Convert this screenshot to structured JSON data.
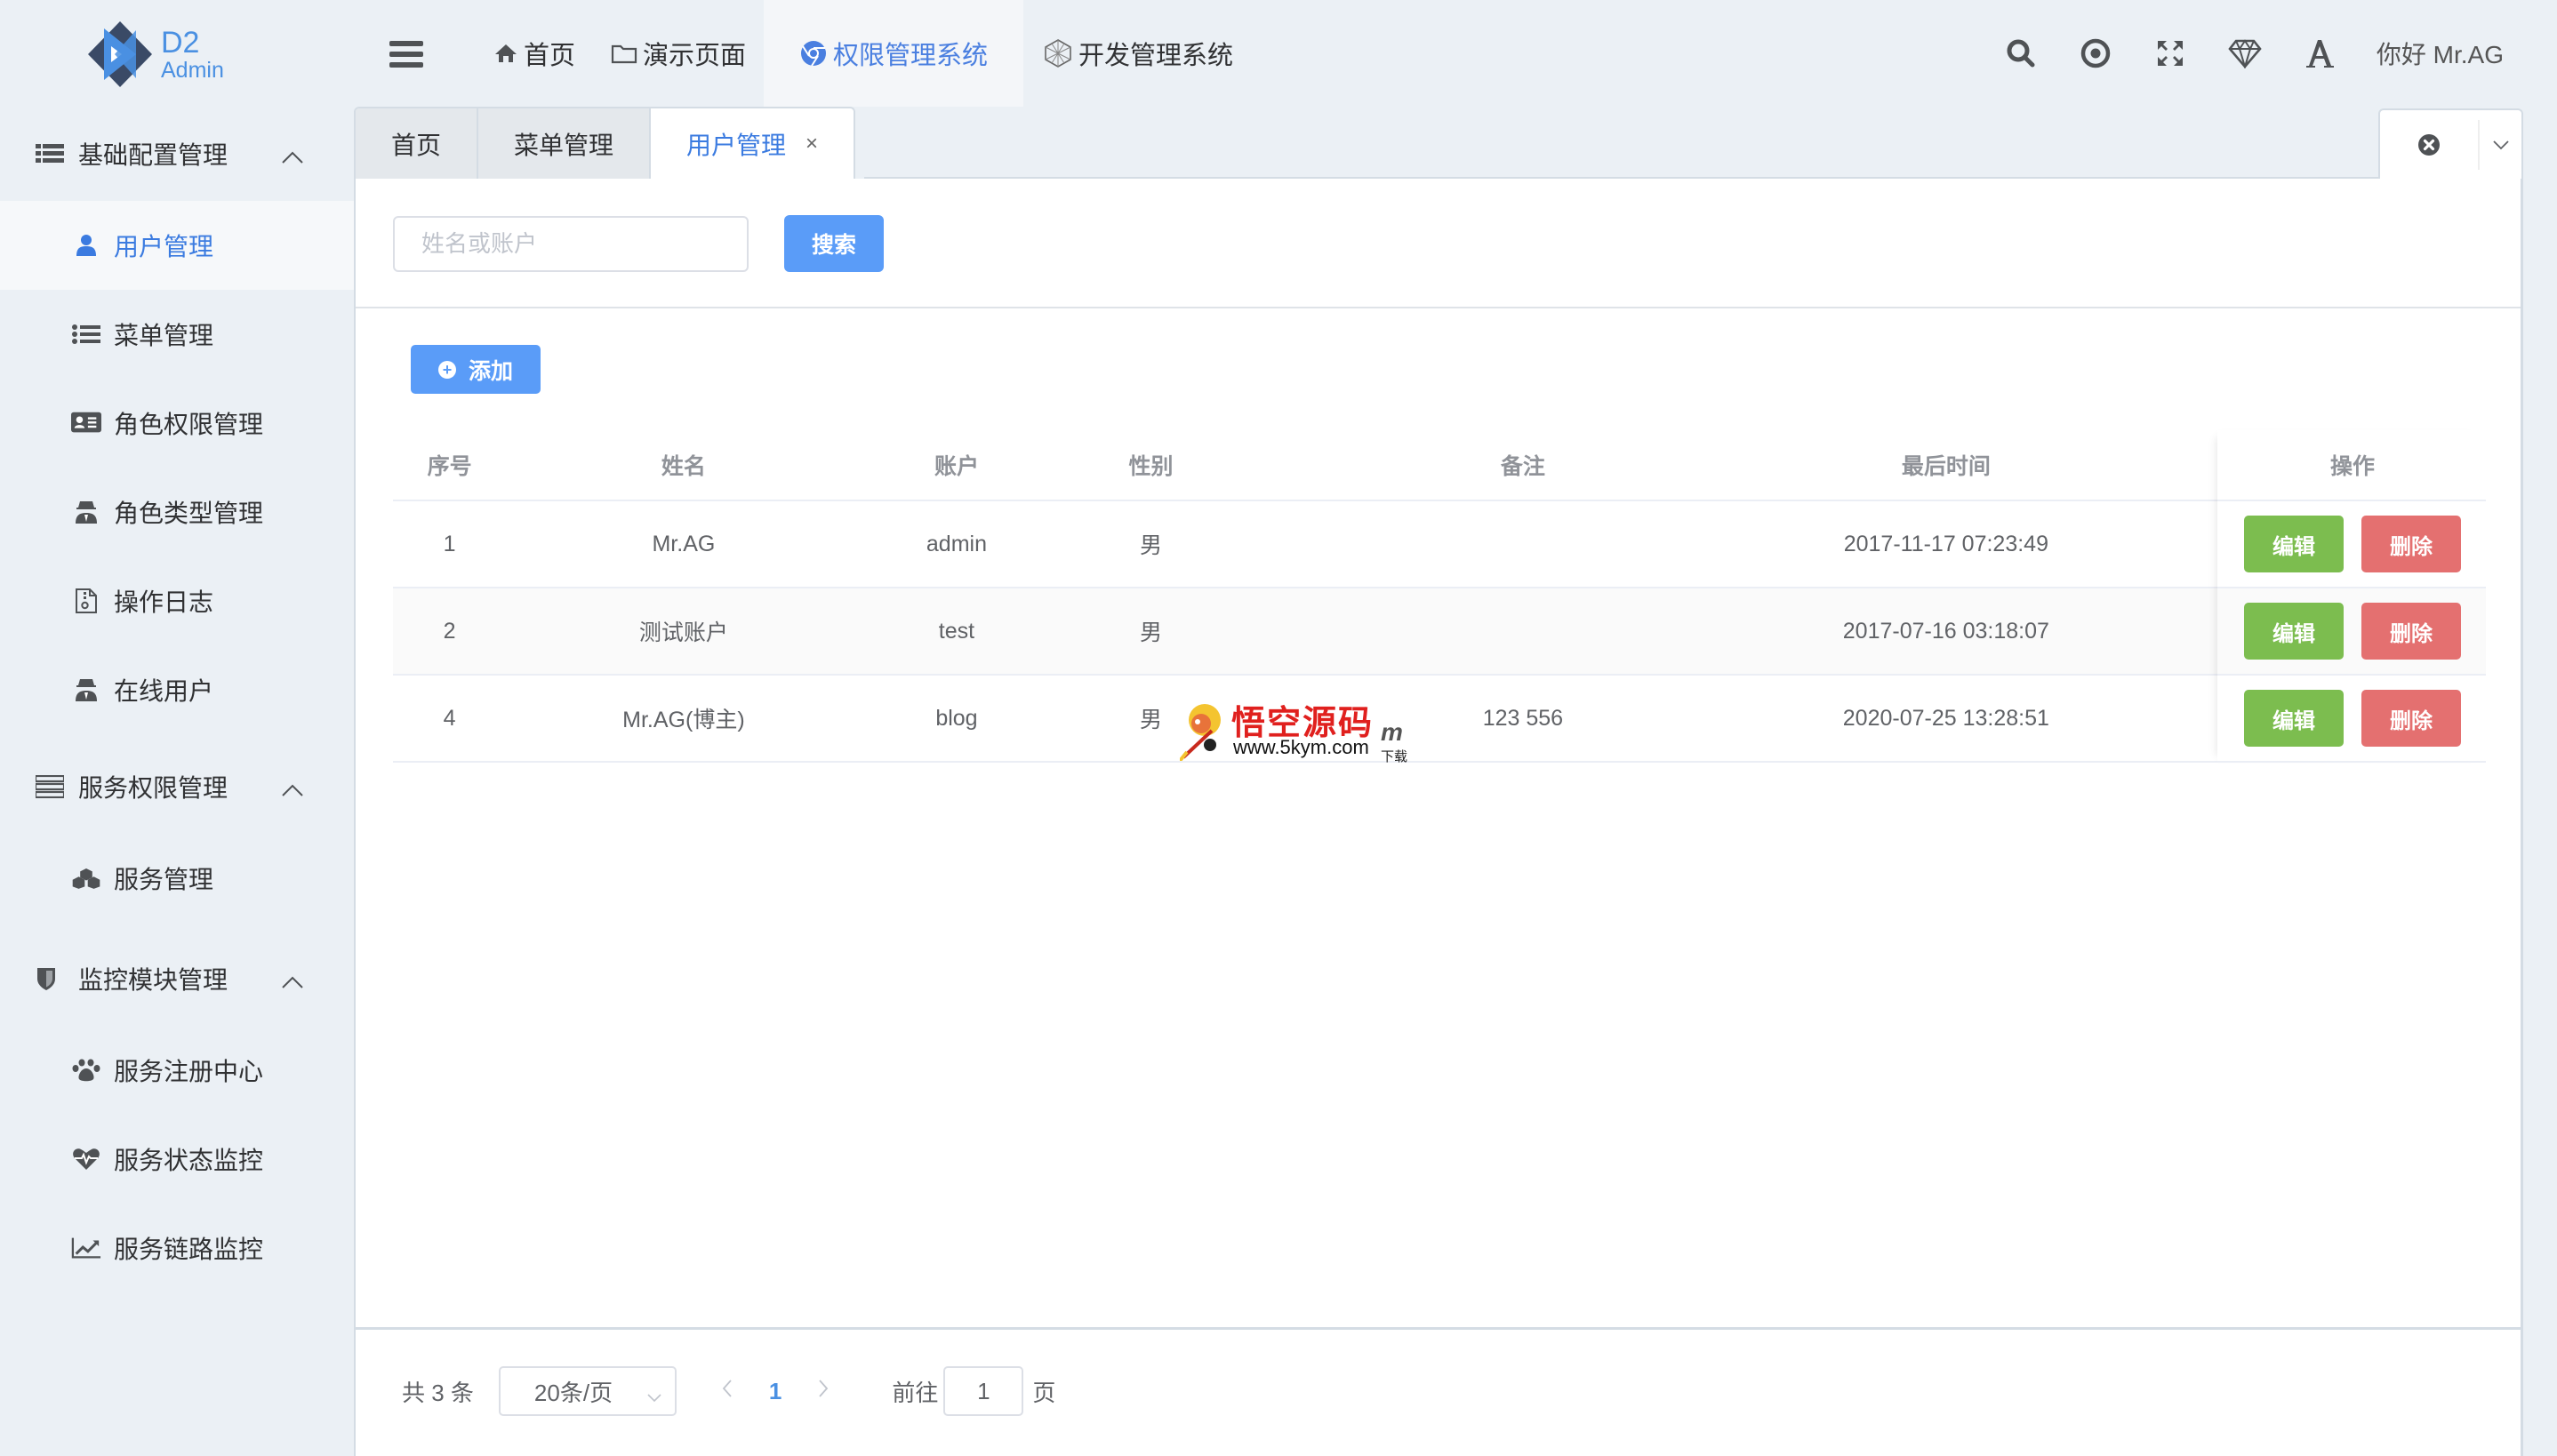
{
  "brand": {
    "line1": "D2",
    "line2": "Admin",
    "accent": "#4a90e2"
  },
  "header": {
    "nav": [
      {
        "label": "首页",
        "icon": "home-icon"
      },
      {
        "label": "演示页面",
        "icon": "folder-icon"
      },
      {
        "label": "权限管理系统",
        "icon": "chrome-icon",
        "active": true
      },
      {
        "label": "开发管理系统",
        "icon": "codepen-icon"
      }
    ],
    "right_icons": [
      "search-icon",
      "target-icon",
      "fullscreen-icon",
      "diamond-icon",
      "font-icon"
    ],
    "greeting": "你好 Mr.AG"
  },
  "sidebar": {
    "groups": [
      {
        "label": "基础配置管理",
        "icon": "list-icon",
        "items": [
          {
            "label": "用户管理",
            "icon": "user-icon",
            "active": true
          },
          {
            "label": "菜单管理",
            "icon": "list-ul-icon"
          },
          {
            "label": "角色权限管理",
            "icon": "id-card-icon"
          },
          {
            "label": "角色类型管理",
            "icon": "user-secret-icon"
          },
          {
            "label": "操作日志",
            "icon": "file-archive-icon"
          },
          {
            "label": "在线用户",
            "icon": "user-secret-icon"
          }
        ]
      },
      {
        "label": "服务权限管理",
        "icon": "server-icon",
        "items": [
          {
            "label": "服务管理",
            "icon": "cubes-icon"
          }
        ]
      },
      {
        "label": "监控模块管理",
        "icon": "shield-icon",
        "items": [
          {
            "label": "服务注册中心",
            "icon": "paw-icon"
          },
          {
            "label": "服务状态监控",
            "icon": "heartbeat-icon"
          },
          {
            "label": "服务链路监控",
            "icon": "line-chart-icon"
          }
        ]
      }
    ]
  },
  "tabs": [
    {
      "label": "首页"
    },
    {
      "label": "菜单管理"
    },
    {
      "label": "用户管理",
      "active": true,
      "close": "×"
    }
  ],
  "search": {
    "placeholder": "姓名或账户",
    "value": "",
    "button": "搜索"
  },
  "toolbar": {
    "add_label": "添加"
  },
  "table": {
    "columns": [
      "序号",
      "姓名",
      "账户",
      "性别",
      "备注",
      "最后时间",
      "操作"
    ],
    "rows": [
      {
        "id": "1",
        "name": "Mr.AG",
        "account": "admin",
        "gender": "男",
        "remark": "",
        "last_time": "2017-11-17 07:23:49"
      },
      {
        "id": "2",
        "name": "测试账户",
        "account": "test",
        "gender": "男",
        "remark": "",
        "last_time": "2017-07-16 03:18:07"
      },
      {
        "id": "4",
        "name": "Mr.AG(博主)",
        "account": "blog",
        "gender": "男",
        "remark": "123 556",
        "last_time": "2020-07-25 13:28:51"
      }
    ],
    "edit_label": "编辑",
    "delete_label": "删除",
    "edit_color": "#7cbd4f",
    "delete_color": "#e47070"
  },
  "watermark": {
    "title": "悟空源码",
    "url": "www.5kym.com",
    "m": "m",
    "suffix": "下载"
  },
  "pagination": {
    "total": "共 3 条",
    "page_size": "20条/页",
    "prev": "‹",
    "current_page": "1",
    "next": "›",
    "goto_label": "前往",
    "goto_value": "1",
    "page_suffix": "页"
  }
}
